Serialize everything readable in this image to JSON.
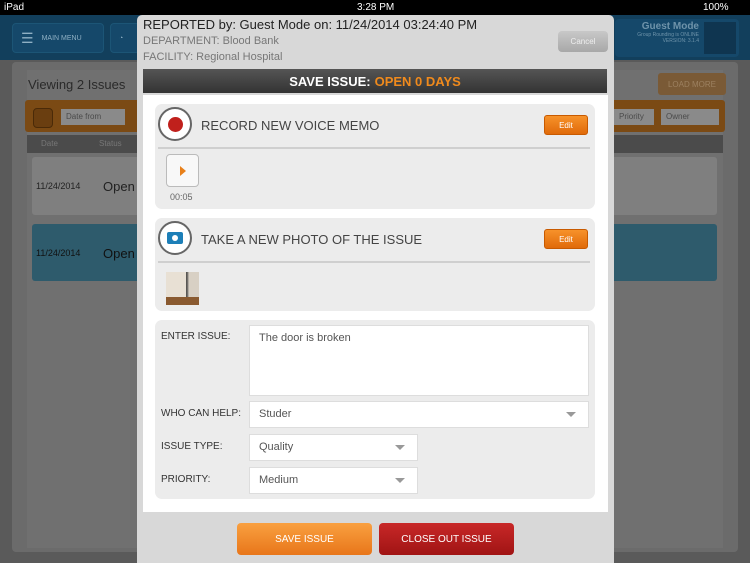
{
  "status_bar": {
    "device": "iPad",
    "time": "3:28 PM",
    "battery": "100%"
  },
  "background": {
    "main_menu": "MAIN MENU",
    "user": {
      "name": "Guest Mode",
      "line1": "Group Rounding is ONLINE",
      "version": "VERSION: 3.1.4"
    },
    "viewing": "Viewing 2 Issues",
    "load_more": "LOAD MORE",
    "filters": {
      "date_from": "Date from",
      "priority": "Priority",
      "owner": "Owner"
    },
    "columns": [
      "Date",
      "Status"
    ],
    "rows": [
      {
        "date": "11/24/2014",
        "status": "Open"
      },
      {
        "date": "11/24/2014",
        "status": "Open"
      }
    ],
    "row_colors": [
      "#8a8a8a",
      "#2e5b6c"
    ]
  },
  "modal": {
    "reported": "REPORTED by: Guest Mode on: 11/24/2014 03:24:40 PM",
    "department": "DEPARTMENT: Blood Bank",
    "facility": "FACILITY: Regional Hospital",
    "cancel": "Cancel",
    "save_bar": {
      "label": "SAVE ISSUE:",
      "status": "OPEN 0 DAYS"
    },
    "voice": {
      "title": "RECORD NEW VOICE MEMO",
      "edit": "Edit",
      "duration": "00:05",
      "icon": "record-icon"
    },
    "photo": {
      "title": "TAKE A NEW PHOTO OF THE ISSUE",
      "edit": "Edit",
      "icon": "camera-icon"
    },
    "form": {
      "issue_label": "ENTER ISSUE:",
      "issue_value": "The door is broken",
      "help_label": "WHO CAN HELP:",
      "help_value": "Studer",
      "type_label": "ISSUE TYPE:",
      "type_value": "Quality",
      "priority_label": "PRIORITY:",
      "priority_value": "Medium"
    },
    "save_button": "SAVE ISSUE",
    "close_button": "CLOSE OUT ISSUE"
  },
  "colors": {
    "accent": "#f08a1c",
    "close": "#b81c1c",
    "record": "#c0201c",
    "camera": "#1d7fb8"
  }
}
